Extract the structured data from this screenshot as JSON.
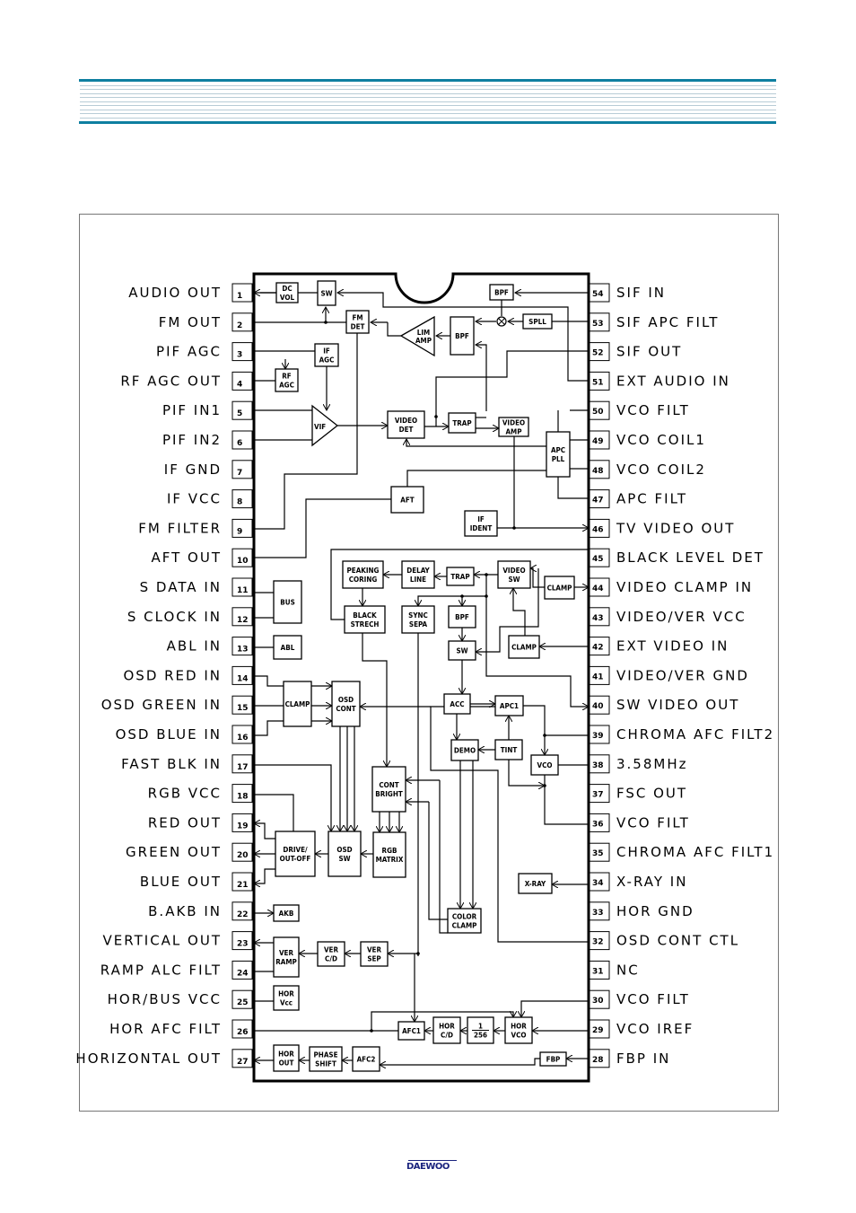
{
  "header": {
    "accent_color": "#0e7fa0",
    "stripe_color": "#b8ccd6"
  },
  "left_pins": [
    {
      "num": "1",
      "label": "AUDIO OUT"
    },
    {
      "num": "2",
      "label": "FM OUT"
    },
    {
      "num": "3",
      "label": "PIF AGC"
    },
    {
      "num": "4",
      "label": "RF AGC OUT"
    },
    {
      "num": "5",
      "label": "PIF IN1"
    },
    {
      "num": "6",
      "label": "PIF IN2"
    },
    {
      "num": "7",
      "label": "IF GND"
    },
    {
      "num": "8",
      "label": "IF VCC"
    },
    {
      "num": "9",
      "label": "FM FILTER"
    },
    {
      "num": "10",
      "label": "AFT OUT"
    },
    {
      "num": "11",
      "label": "S DATA IN"
    },
    {
      "num": "12",
      "label": "S CLOCK IN"
    },
    {
      "num": "13",
      "label": "ABL IN"
    },
    {
      "num": "14",
      "label": "OSD RED IN"
    },
    {
      "num": "15",
      "label": "OSD GREEN IN"
    },
    {
      "num": "16",
      "label": "OSD BLUE IN"
    },
    {
      "num": "17",
      "label": "FAST BLK IN"
    },
    {
      "num": "18",
      "label": "RGB VCC"
    },
    {
      "num": "19",
      "label": "RED OUT"
    },
    {
      "num": "20",
      "label": "GREEN OUT"
    },
    {
      "num": "21",
      "label": "BLUE OUT"
    },
    {
      "num": "22",
      "label": "B.AKB IN"
    },
    {
      "num": "23",
      "label": "VERTICAL OUT"
    },
    {
      "num": "24",
      "label": "RAMP ALC FILT"
    },
    {
      "num": "25",
      "label": "HOR/BUS VCC"
    },
    {
      "num": "26",
      "label": "HOR AFC FILT"
    },
    {
      "num": "27",
      "label": "HORIZONTAL OUT"
    }
  ],
  "right_pins": [
    {
      "num": "54",
      "label": "SIF IN"
    },
    {
      "num": "53",
      "label": "SIF APC FILT"
    },
    {
      "num": "52",
      "label": "SIF OUT"
    },
    {
      "num": "51",
      "label": "EXT AUDIO IN"
    },
    {
      "num": "50",
      "label": "VCO FILT"
    },
    {
      "num": "49",
      "label": "VCO COIL1"
    },
    {
      "num": "48",
      "label": "VCO COIL2"
    },
    {
      "num": "47",
      "label": "APC FILT"
    },
    {
      "num": "46",
      "label": "TV VIDEO OUT"
    },
    {
      "num": "45",
      "label": "BLACK LEVEL DET"
    },
    {
      "num": "44",
      "label": "VIDEO CLAMP IN"
    },
    {
      "num": "43",
      "label": "VIDEO/VER VCC"
    },
    {
      "num": "42",
      "label": "EXT VIDEO IN"
    },
    {
      "num": "41",
      "label": "VIDEO/VER GND"
    },
    {
      "num": "40",
      "label": "SW VIDEO OUT"
    },
    {
      "num": "39",
      "label": "CHROMA AFC FILT2"
    },
    {
      "num": "38",
      "label": "3.58MHz"
    },
    {
      "num": "37",
      "label": "FSC OUT"
    },
    {
      "num": "36",
      "label": "VCO FILT"
    },
    {
      "num": "35",
      "label": "CHROMA AFC FILT1"
    },
    {
      "num": "34",
      "label": "X-RAY IN"
    },
    {
      "num": "33",
      "label": "HOR GND"
    },
    {
      "num": "32",
      "label": "OSD CONT CTL"
    },
    {
      "num": "31",
      "label": "NC"
    },
    {
      "num": "30",
      "label": "VCO FILT"
    },
    {
      "num": "29",
      "label": "VCO IREF"
    },
    {
      "num": "28",
      "label": "FBP IN"
    }
  ],
  "blocks": {
    "dc_vol": [
      "DC",
      "VOL"
    ],
    "sw_audio": [
      "SW"
    ],
    "fm_det": [
      "FM",
      "DET"
    ],
    "lim_amp": [
      "LIM",
      "AMP"
    ],
    "bpf_sif": [
      "BPF"
    ],
    "bpf_top": [
      "BPF"
    ],
    "spll": [
      "SPLL"
    ],
    "if_agc": [
      "IF",
      "AGC"
    ],
    "rf_agc": [
      "RF",
      "AGC"
    ],
    "vif": [
      "VIF"
    ],
    "video_det": [
      "VIDEO",
      "DET"
    ],
    "trap_if": [
      "TRAP"
    ],
    "video_amp": [
      "VIDEO",
      "AMP"
    ],
    "apc_pll": [
      "APC",
      "PLL"
    ],
    "aft": [
      "AFT"
    ],
    "if_ident": [
      "IF",
      "IDENT"
    ],
    "peaking": [
      "PEAKING",
      "CORING"
    ],
    "delay_line": [
      "DELAY",
      "LINE"
    ],
    "trap_video": [
      "TRAP"
    ],
    "video_sw": [
      "VIDEO",
      "SW"
    ],
    "clamp_44": [
      "CLAMP"
    ],
    "bus": [
      "BUS"
    ],
    "black_strech": [
      "BLACK",
      "STRECH"
    ],
    "sync_sepa": [
      "SYNC",
      "SEPA"
    ],
    "bpf_chroma": [
      "BPF"
    ],
    "sw_chroma": [
      "SW"
    ],
    "clamp_42": [
      "CLAMP"
    ],
    "abl": [
      "ABL"
    ],
    "clamp_osd": [
      "CLAMP"
    ],
    "osd_cont": [
      "OSD",
      "CONT"
    ],
    "acc": [
      "ACC"
    ],
    "apc1": [
      "APC1"
    ],
    "demo": [
      "DEMO"
    ],
    "tint": [
      "TINT"
    ],
    "vco": [
      "VCO"
    ],
    "cont_bright": [
      "CONT",
      "BRIGHT"
    ],
    "drive": [
      "DRIVE/",
      "OUT-OFF"
    ],
    "osd_sw": [
      "OSD",
      "SW"
    ],
    "rgb_matrix": [
      "RGB",
      "MATRIX"
    ],
    "xray": [
      "X-RAY"
    ],
    "akb": [
      "AKB"
    ],
    "color_clamp": [
      "COLOR",
      "CLAMP"
    ],
    "ver_ramp": [
      "VER",
      "RAMP"
    ],
    "ver_cd": [
      "VER",
      "C/D"
    ],
    "ver_sep": [
      "VER",
      "SEP"
    ],
    "hor_vcc": [
      "HOR",
      "Vcc"
    ],
    "afc1": [
      "AFC1"
    ],
    "hor_cd": [
      "HOR",
      "C/D"
    ],
    "div256": [
      "1",
      "256"
    ],
    "hor_vco": [
      "HOR",
      "VCO"
    ],
    "hor_out": [
      "HOR",
      "OUT"
    ],
    "phase_shift": [
      "PHASE",
      "SHIFT"
    ],
    "afc2": [
      "AFC2"
    ],
    "fbp": [
      "FBP"
    ]
  },
  "footer": {
    "logo": "DAEWOO",
    "logo_color": "#1a237e"
  }
}
